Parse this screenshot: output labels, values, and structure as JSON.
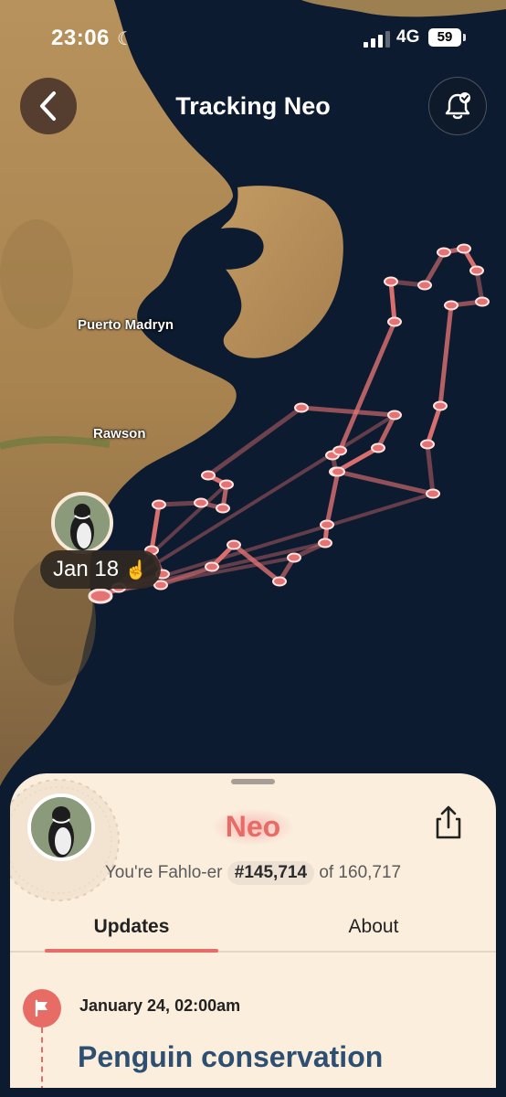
{
  "status_bar": {
    "time": "23:06",
    "network": "4G",
    "battery": "59"
  },
  "nav": {
    "title": "Tracking Neo"
  },
  "map": {
    "labels": [
      "Puerto Madryn",
      "Rawson"
    ],
    "current_date": "Jan 18",
    "track_color": "#e57373"
  },
  "profile": {
    "name": "Neo",
    "rank_prefix": "You're Fahlo-er",
    "rank": "#145,714",
    "rank_of": "of 160,717"
  },
  "tabs": [
    {
      "label": "Updates",
      "active": true
    },
    {
      "label": "About",
      "active": false
    }
  ],
  "update": {
    "date": "January 24, 02:00am",
    "title": "Penguin conservation"
  },
  "icons": [
    "back-icon",
    "bell-check-icon",
    "share-icon",
    "flag-icon",
    "moon-icon",
    "signal-icon",
    "battery-icon"
  ]
}
